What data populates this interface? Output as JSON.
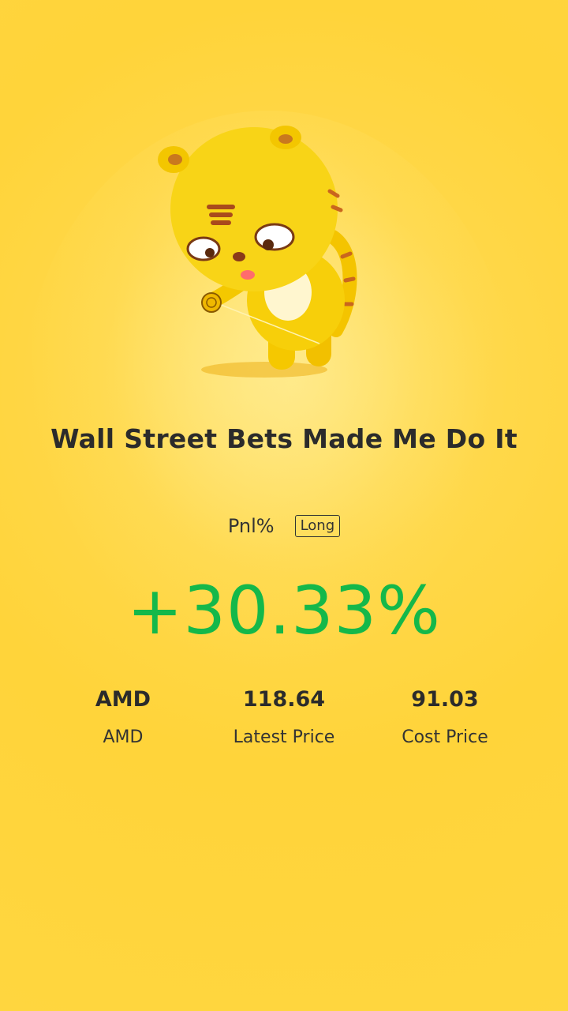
{
  "card": {
    "title": "Wall Street Bets Made Me Do It",
    "pnl_label": "Pnl%",
    "position_badge": "Long",
    "pnl_value": "+30.33%",
    "pnl_color": "#14b84a",
    "mascot": "yellow-tiger-yoyo-mascot"
  },
  "stats": [
    {
      "value": "AMD",
      "label": "AMD"
    },
    {
      "value": "118.64",
      "label": "Latest Price"
    },
    {
      "value": "91.03",
      "label": "Cost Price"
    }
  ]
}
